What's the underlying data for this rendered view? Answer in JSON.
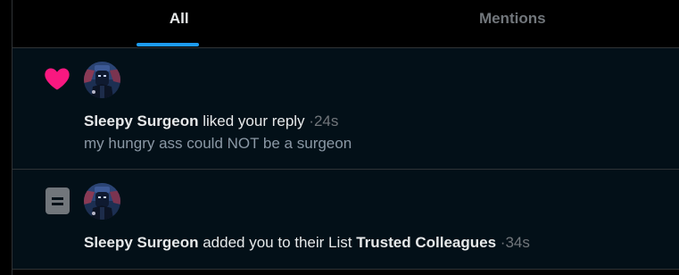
{
  "tabs": [
    {
      "label": "All",
      "selected": true
    },
    {
      "label": "Mentions",
      "selected": false
    }
  ],
  "notifications": [
    {
      "type_icon": "heart-icon",
      "icon_color": "#f91880",
      "user_name": "Sleepy Surgeon",
      "action": "liked your reply",
      "separator": "·",
      "time": "24s",
      "preview": "my hungry ass could NOT be a surgeon"
    },
    {
      "type_icon": "list-icon",
      "icon_color": "#71767b",
      "user_name": "Sleepy Surgeon",
      "action": "added you to their List",
      "list_name": "Trusted Colleagues",
      "separator": "·",
      "time": "34s"
    }
  ],
  "colors": {
    "accent": "#1d9bf0",
    "like": "#f91880",
    "background": "#000000",
    "notification_background": "#031018",
    "secondary_text": "#71767b",
    "primary_text": "#e7e9ea"
  }
}
